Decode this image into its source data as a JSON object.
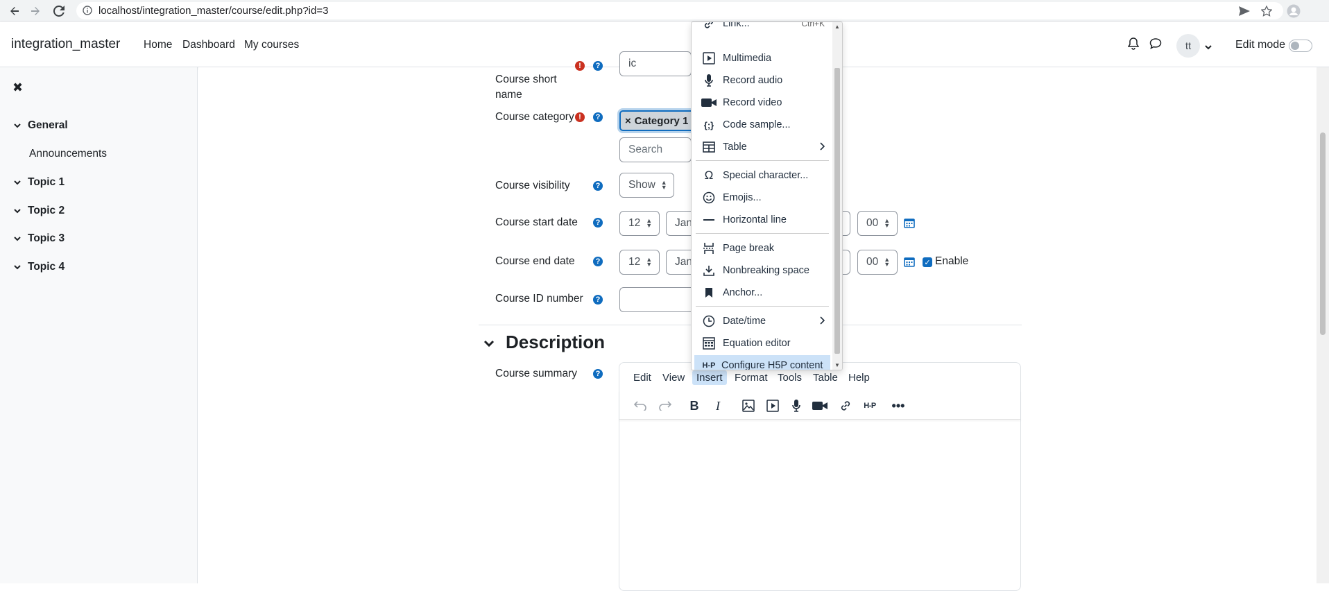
{
  "browser": {
    "url": "localhost/integration_master/course/edit.php?id=3"
  },
  "navbar": {
    "site_name": "integration_master",
    "links": [
      "Home",
      "Dashboard",
      "My courses"
    ],
    "avatar_initials": "tt",
    "edit_mode_label": "Edit mode"
  },
  "drawer": {
    "sections": [
      {
        "label": "General",
        "items": [
          "Announcements"
        ]
      },
      {
        "label": "Topic 1"
      },
      {
        "label": "Topic 2"
      },
      {
        "label": "Topic 3"
      },
      {
        "label": "Topic 4"
      }
    ]
  },
  "form": {
    "short_name_label_line1": "Course short",
    "short_name_label_line2": "name",
    "short_name_value": "ic",
    "category_label": "Course category",
    "category_chip": "Category 1",
    "category_chip_remove": "×",
    "search_placeholder": "Search",
    "visibility_label": "Course visibility",
    "visibility_value": "Show",
    "start_date_label": "Course start date",
    "start_day": "12",
    "start_month": "Jan",
    "start_minute": "00",
    "end_date_label": "Course end date",
    "end_day": "12",
    "end_month": "Jan",
    "end_minute": "00",
    "enable_label": "Enable",
    "id_number_label": "Course ID number",
    "description_heading": "Description",
    "summary_label": "Course summary"
  },
  "editor": {
    "menus": [
      "Edit",
      "View",
      "Insert",
      "Format",
      "Tools",
      "Table",
      "Help"
    ],
    "active_menu": "Insert"
  },
  "insert_menu": {
    "items": [
      {
        "label": "Link...",
        "icon": "link-icon",
        "shortcut": "Ctrl+K"
      },
      {
        "label": "Multimedia",
        "icon": "multimedia-icon"
      },
      {
        "label": "Record audio",
        "icon": "microphone-icon"
      },
      {
        "label": "Record video",
        "icon": "video-camera-icon"
      },
      {
        "label": "Code sample...",
        "icon": "code-sample-icon"
      },
      {
        "label": "Table",
        "icon": "table-icon",
        "submenu": true
      },
      {
        "label": "Special character...",
        "icon": "omega-icon"
      },
      {
        "label": "Emojis...",
        "icon": "emoji-icon"
      },
      {
        "label": "Horizontal line",
        "icon": "horizontal-line-icon"
      },
      {
        "label": "Page break",
        "icon": "page-break-icon"
      },
      {
        "label": "Nonbreaking space",
        "icon": "nonbreaking-space-icon"
      },
      {
        "label": "Anchor...",
        "icon": "bookmark-icon"
      },
      {
        "label": "Date/time",
        "icon": "clock-icon",
        "submenu": true
      },
      {
        "label": "Equation editor",
        "icon": "calculator-icon"
      },
      {
        "label": "Configure H5P content",
        "icon": "h5p-icon",
        "highlighted": true
      }
    ]
  },
  "colors": {
    "primary": "#0f6cbf",
    "required": "#ca3120",
    "menu_highlight": "#cce2f8"
  }
}
